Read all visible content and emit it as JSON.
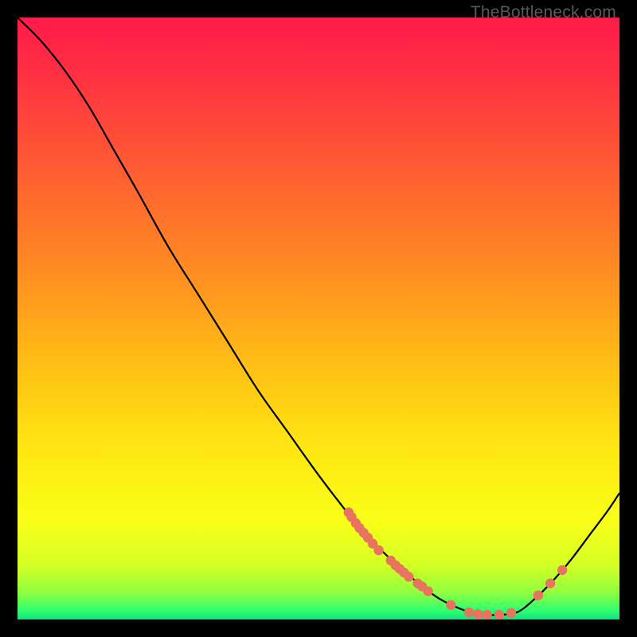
{
  "watermark": "TheBottleneck.com",
  "chart_data": {
    "type": "line",
    "title": "",
    "xlabel": "",
    "ylabel": "",
    "xlim": [
      0,
      100
    ],
    "ylim": [
      0,
      100
    ],
    "curve": [
      {
        "x": 0,
        "y": 100
      },
      {
        "x": 4,
        "y": 96
      },
      {
        "x": 8,
        "y": 91
      },
      {
        "x": 12,
        "y": 85
      },
      {
        "x": 16,
        "y": 78
      },
      {
        "x": 20,
        "y": 71
      },
      {
        "x": 25,
        "y": 62
      },
      {
        "x": 30,
        "y": 54
      },
      {
        "x": 35,
        "y": 46
      },
      {
        "x": 40,
        "y": 38
      },
      {
        "x": 45,
        "y": 31
      },
      {
        "x": 50,
        "y": 24
      },
      {
        "x": 55,
        "y": 17.5
      },
      {
        "x": 58,
        "y": 14
      },
      {
        "x": 62,
        "y": 10
      },
      {
        "x": 66,
        "y": 6.5
      },
      {
        "x": 70,
        "y": 3.5
      },
      {
        "x": 74,
        "y": 1.6
      },
      {
        "x": 77,
        "y": 0.8
      },
      {
        "x": 80,
        "y": 0.8
      },
      {
        "x": 83,
        "y": 1.2
      },
      {
        "x": 86,
        "y": 3.5
      },
      {
        "x": 89,
        "y": 6.5
      },
      {
        "x": 92,
        "y": 10
      },
      {
        "x": 95,
        "y": 14
      },
      {
        "x": 98,
        "y": 18
      },
      {
        "x": 100,
        "y": 21
      }
    ],
    "dots": [
      {
        "x": 55,
        "y": 17.8
      },
      {
        "x": 55.5,
        "y": 17
      },
      {
        "x": 56.2,
        "y": 16
      },
      {
        "x": 56.8,
        "y": 15.2
      },
      {
        "x": 57.5,
        "y": 14.4
      },
      {
        "x": 58.2,
        "y": 13.6
      },
      {
        "x": 59,
        "y": 12.6
      },
      {
        "x": 60,
        "y": 11.5
      },
      {
        "x": 62,
        "y": 9.8
      },
      {
        "x": 62.8,
        "y": 9
      },
      {
        "x": 63.5,
        "y": 8.4
      },
      {
        "x": 64.2,
        "y": 7.8
      },
      {
        "x": 65,
        "y": 7.1
      },
      {
        "x": 66.5,
        "y": 6
      },
      {
        "x": 67.2,
        "y": 5.5
      },
      {
        "x": 68.2,
        "y": 4.7
      },
      {
        "x": 72,
        "y": 2.4
      },
      {
        "x": 75,
        "y": 1.2
      },
      {
        "x": 76.5,
        "y": 0.9
      },
      {
        "x": 78,
        "y": 0.8
      },
      {
        "x": 80,
        "y": 0.8
      },
      {
        "x": 82,
        "y": 1.1
      },
      {
        "x": 86.5,
        "y": 4
      },
      {
        "x": 88.5,
        "y": 6
      },
      {
        "x": 90.5,
        "y": 8.2
      }
    ],
    "gradient_stops": [
      {
        "offset": 0,
        "color": "#ff1a4a"
      },
      {
        "offset": 0.12,
        "color": "#ff3740"
      },
      {
        "offset": 0.28,
        "color": "#ff6530"
      },
      {
        "offset": 0.44,
        "color": "#ff9220"
      },
      {
        "offset": 0.58,
        "color": "#ffc015"
      },
      {
        "offset": 0.72,
        "color": "#ffe812"
      },
      {
        "offset": 0.84,
        "color": "#f8ff18"
      },
      {
        "offset": 0.91,
        "color": "#d4ff25"
      },
      {
        "offset": 0.955,
        "color": "#90ff40"
      },
      {
        "offset": 0.985,
        "color": "#30ff70"
      },
      {
        "offset": 1.0,
        "color": "#10e080"
      }
    ],
    "dot_color": "#e8735f",
    "curve_color": "#000000"
  }
}
